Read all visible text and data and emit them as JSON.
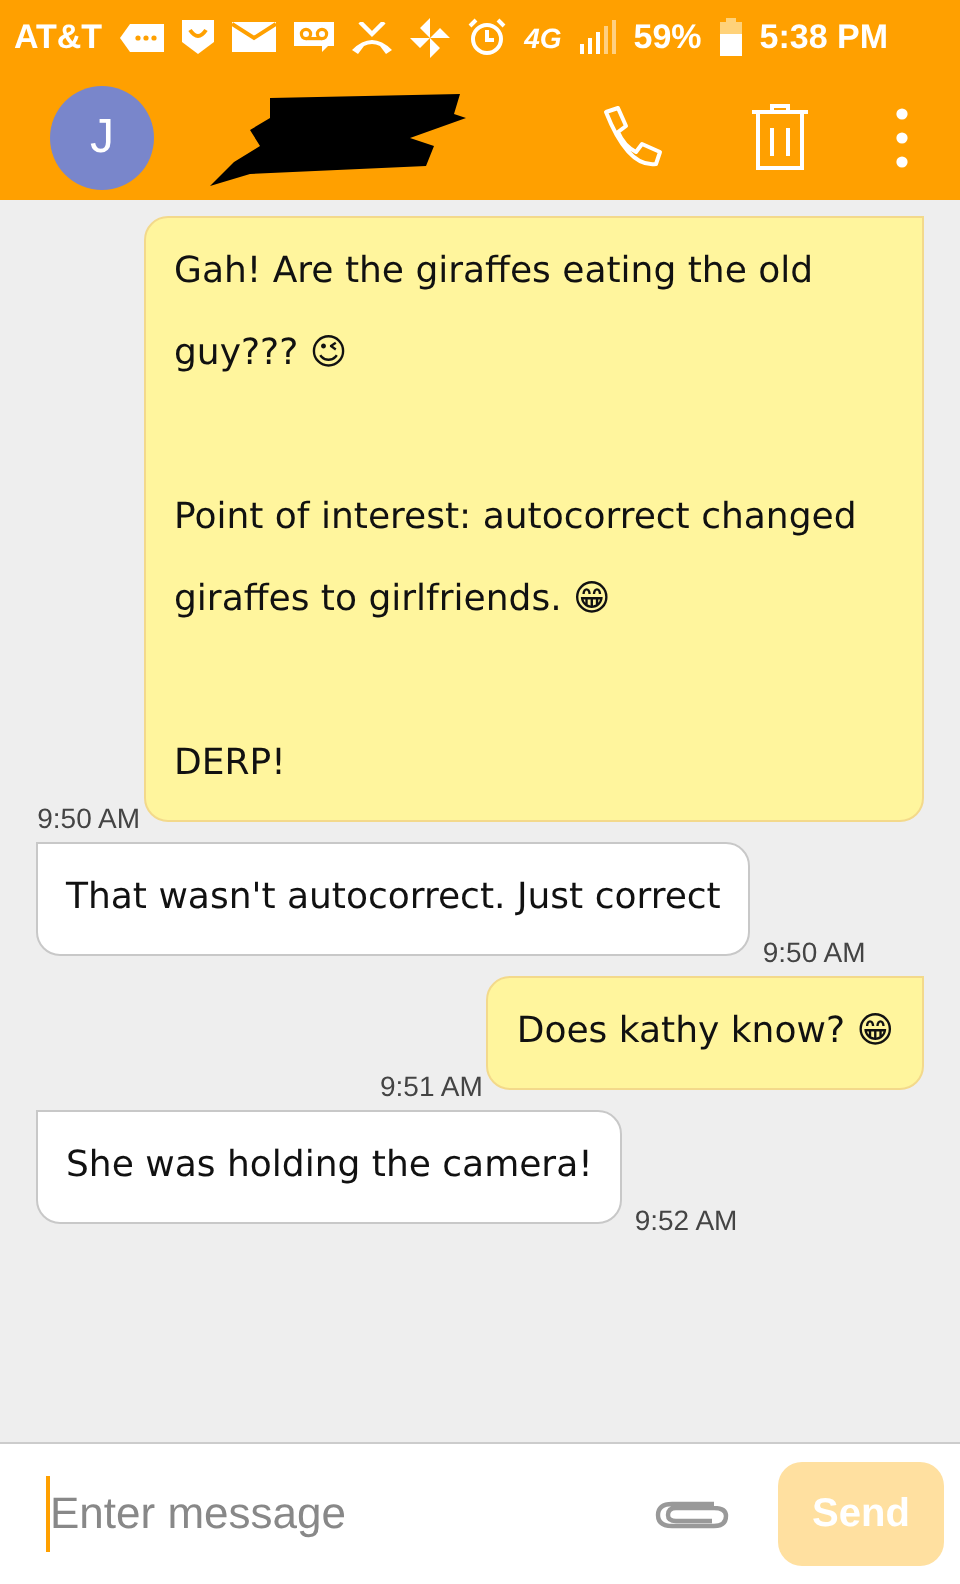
{
  "status_bar": {
    "carrier": "AT&T",
    "network": "4G",
    "battery": "59%",
    "time": "5:38 PM"
  },
  "header": {
    "avatar_initial": "J",
    "name_redacted": true
  },
  "messages": [
    {
      "sent": true,
      "paragraphs": [
        {
          "text": "Gah! Are the giraffes eating the old guy??? 😉"
        },
        {
          "text": "Point of interest: autocorrect changed giraffes to girlfriends. 😁"
        },
        {
          "text": "DERP!"
        }
      ],
      "time": "9:50 AM"
    },
    {
      "sent": false,
      "paragraphs": [
        {
          "text": "That wasn't autocorrect. Just correct"
        }
      ],
      "time": "9:50 AM"
    },
    {
      "sent": true,
      "paragraphs": [
        {
          "text": "Does kathy know? 😁"
        }
      ],
      "time": "9:51 AM"
    },
    {
      "sent": false,
      "paragraphs": [
        {
          "text": "She was holding the camera!"
        }
      ],
      "time": "9:52 AM"
    }
  ],
  "composer": {
    "placeholder": "Enter message",
    "send_label": "Send",
    "send_disabled": true
  }
}
